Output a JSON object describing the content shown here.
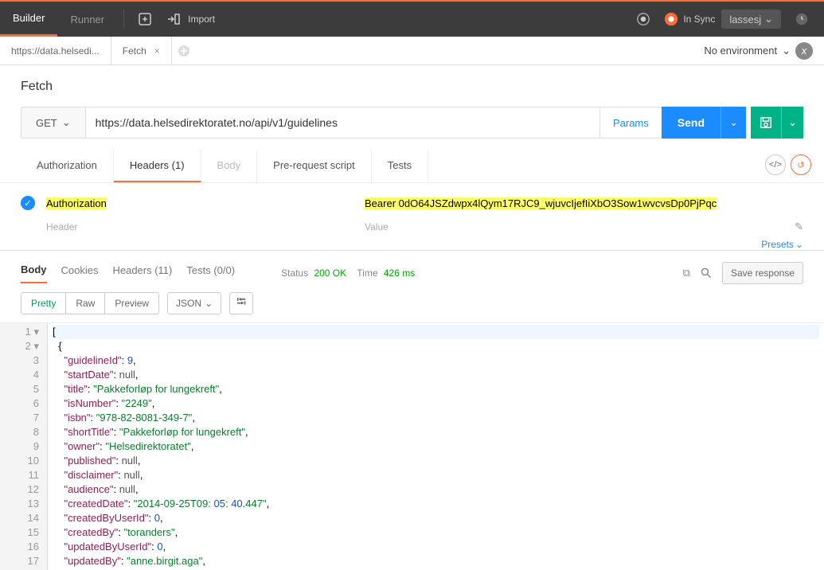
{
  "topbar": {
    "tabs": [
      "Builder",
      "Runner"
    ],
    "import": "Import",
    "sync": "In Sync",
    "user": "lassesj"
  },
  "doctabs": {
    "items": [
      {
        "label": "https://data.helsedi..."
      },
      {
        "label": "Fetch"
      }
    ]
  },
  "env": {
    "label": "No environment"
  },
  "request": {
    "title": "Fetch",
    "method": "GET",
    "url": "https://data.helsedirektoratet.no/api/v1/guidelines",
    "params_label": "Params",
    "send_label": "Send"
  },
  "reqtabs": {
    "auth": "Authorization",
    "headers": "Headers (1)",
    "body": "Body",
    "prereq": "Pre-request script",
    "tests": "Tests"
  },
  "headers": {
    "row": {
      "key": "Authorization",
      "value": "Bearer 0dO64JSZdwpx4lQym17RJC9_wjuvcIjefIiXbO3Sow1wvcvsDp0PjPqc"
    },
    "header_placeholder": "Header",
    "value_placeholder": "Value",
    "presets": "Presets"
  },
  "response": {
    "tabs": {
      "body": "Body",
      "cookies": "Cookies",
      "headers": "Headers (11)",
      "tests": "Tests (0/0)"
    },
    "status_label": "Status",
    "status_value": "200 OK",
    "time_label": "Time",
    "time_value": "426 ms",
    "save": "Save response",
    "view": {
      "pretty": "Pretty",
      "raw": "Raw",
      "preview": "Preview",
      "format": "JSON"
    }
  },
  "json_body": {
    "lines": [
      "[",
      "  {",
      "    \"guidelineId\": 9,",
      "    \"startDate\": null,",
      "    \"title\": \"Pakkeforløp for lungekreft\",",
      "    \"isNumber\": \"2249\",",
      "    \"isbn\": \"978-82-8081-349-7\",",
      "    \"shortTitle\": \"Pakkeforløp for lungekreft\",",
      "    \"owner\": \"Helsedirektoratet\",",
      "    \"published\": null,",
      "    \"disclaimer\": null,",
      "    \"audience\": null,",
      "    \"createdDate\": \"2014-09-25T09:05:40.447\",",
      "    \"createdByUserId\": 0,",
      "    \"createdBy\": \"toranders\",",
      "    \"updatedByUserId\": 0,",
      "    \"updatedBy\": \"anne.birgit.aga\","
    ]
  }
}
